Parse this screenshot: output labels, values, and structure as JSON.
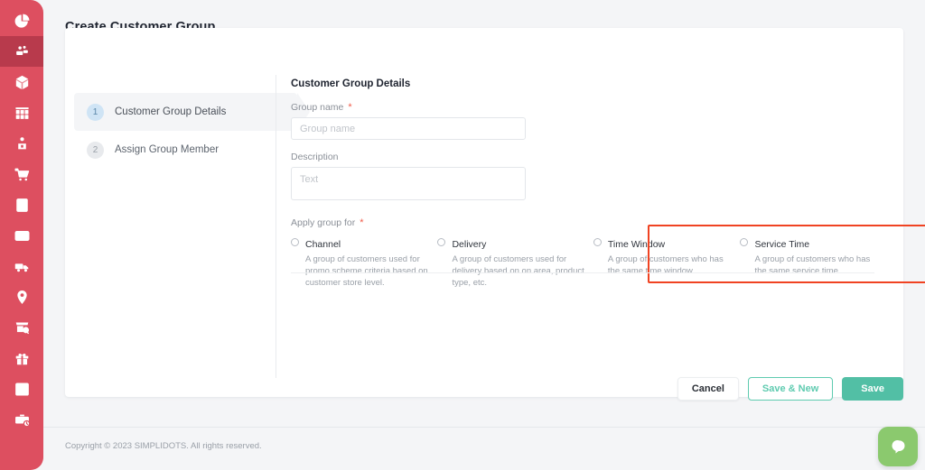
{
  "sidebar": {
    "bg_color": "#dd4f60",
    "active_bg_color": "#b83a4c",
    "items": [
      {
        "icon": "pie-chart-icon",
        "active": false
      },
      {
        "icon": "customer-group-icon",
        "active": true
      },
      {
        "icon": "package-box-icon",
        "active": false
      },
      {
        "icon": "store-shelf-icon",
        "active": false
      },
      {
        "icon": "salesman-icon",
        "active": false
      },
      {
        "icon": "shopping-cart-icon",
        "active": false
      },
      {
        "icon": "invoice-icon",
        "active": false
      },
      {
        "icon": "payment-card-icon",
        "active": false
      },
      {
        "icon": "delivery-truck-icon",
        "active": false
      },
      {
        "icon": "map-pin-icon",
        "active": false
      },
      {
        "icon": "store-search-icon",
        "active": false
      },
      {
        "icon": "gift-promo-icon",
        "active": false
      },
      {
        "icon": "report-table-icon",
        "active": false
      },
      {
        "icon": "briefcase-clock-icon",
        "active": false
      }
    ]
  },
  "page": {
    "title": "Create Customer Group"
  },
  "stepper": {
    "steps": [
      {
        "number": "1",
        "label": "Customer Group Details",
        "state": "active"
      },
      {
        "number": "2",
        "label": "Assign Group Member",
        "state": "idle"
      }
    ]
  },
  "form": {
    "title": "Customer Group Details",
    "group_name": {
      "label": "Group name",
      "required_mark": "*",
      "placeholder": "Group name",
      "value": ""
    },
    "description": {
      "label": "Description",
      "placeholder": "Text",
      "value": ""
    },
    "apply_group_for": {
      "label": "Apply group for",
      "required_mark": "*",
      "selected": null,
      "options": [
        {
          "title": "Channel",
          "description": "A group of customers used for promo scheme criteria based on customer store level.",
          "selected": false,
          "highlighted": false
        },
        {
          "title": "Delivery",
          "description": "A group of customers used for delivery based on on area, product type, etc.",
          "selected": false,
          "highlighted": false
        },
        {
          "title": "Time Window",
          "description": "A group of customers who has the same time window.",
          "selected": false,
          "highlighted": true
        },
        {
          "title": "Service Time",
          "description": "A group of customers who has the same service time.",
          "selected": false,
          "highlighted": true
        }
      ]
    }
  },
  "annotation": {
    "border_color": "#f04322"
  },
  "actions": {
    "cancel_label": "Cancel",
    "save_new_label": "Save & New",
    "save_label": "Save",
    "accent_color": "#52bfa5"
  },
  "footer": {
    "copyright": "Copyright © 2023 SIMPLIDOTS. All rights reserved."
  },
  "chat_widget": {
    "icon": "chat-bubble-icon",
    "color": "#8bc96e"
  }
}
